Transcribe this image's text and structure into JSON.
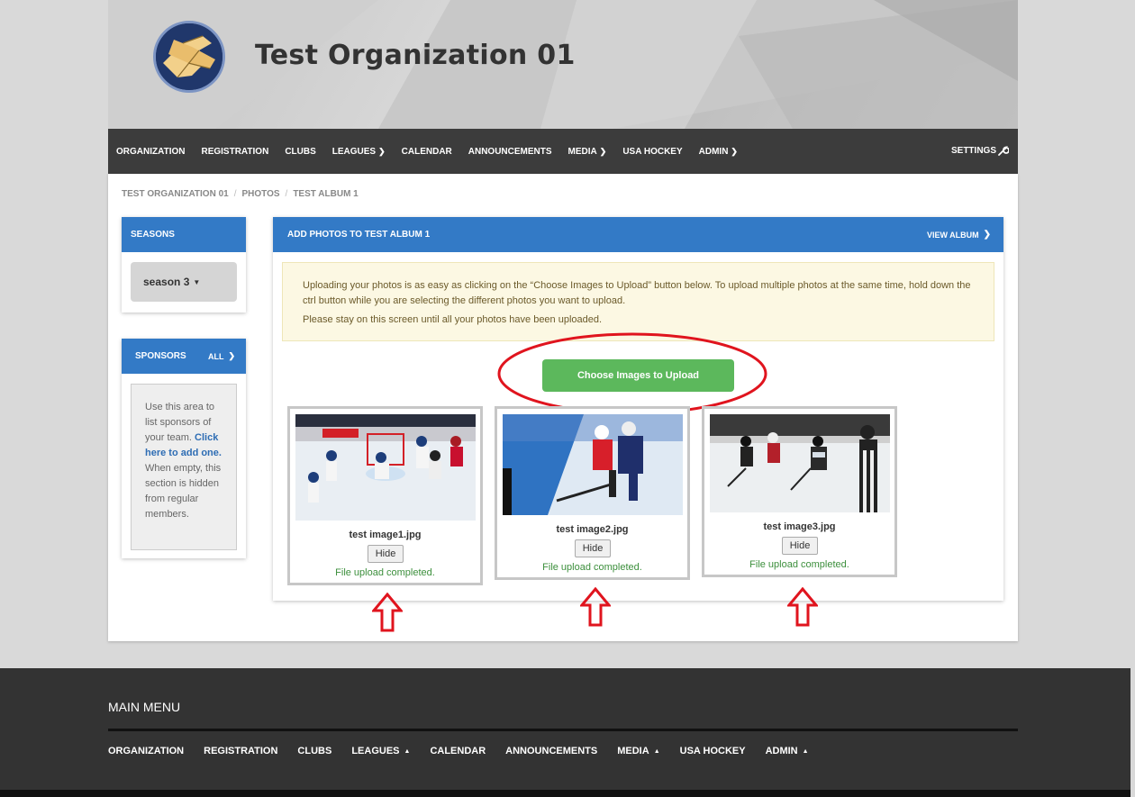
{
  "header": {
    "org_name": "Test Organization 01",
    "logo_icon": "hands-logo-icon"
  },
  "topnav": {
    "items": [
      {
        "label": "ORGANIZATION",
        "dropdown": false
      },
      {
        "label": "REGISTRATION",
        "dropdown": false
      },
      {
        "label": "CLUBS",
        "dropdown": false
      },
      {
        "label": "LEAGUES",
        "dropdown": true
      },
      {
        "label": "CALENDAR",
        "dropdown": false
      },
      {
        "label": "ANNOUNCEMENTS",
        "dropdown": false
      },
      {
        "label": "MEDIA",
        "dropdown": true
      },
      {
        "label": "USA HOCKEY",
        "dropdown": false
      },
      {
        "label": "ADMIN",
        "dropdown": true
      }
    ],
    "settings_label": "SETTINGS"
  },
  "breadcrumb": [
    "TEST ORGANIZATION 01",
    "PHOTOS",
    "TEST ALBUM 1"
  ],
  "sidebar": {
    "seasons_title": "SEASONS",
    "season_selected": "season 3",
    "sponsors_title": "SPONSORS",
    "sponsors_all": "ALL",
    "sponsor_text_1": "Use this area to list sponsors of your team.",
    "sponsor_link": "Click here to add one.",
    "sponsor_text_2": "When empty, this section is hidden from regular members."
  },
  "photo_panel": {
    "title": "ADD PHOTOS TO TEST ALBUM 1",
    "view_album": "VIEW ALBUM",
    "notice_line1": "Uploading your photos is as easy as clicking on the “Choose Images to Upload” button below. To upload multiple photos at the same time, hold down the ctrl button while you are selecting the different photos you want to upload.",
    "notice_line2": "Please stay on this screen until all your photos have been uploaded.",
    "upload_button": "Choose Images to Upload",
    "uploads": [
      {
        "filename": "test image1.jpg",
        "hide_label": "Hide",
        "status": "File upload completed."
      },
      {
        "filename": "test image2.jpg",
        "hide_label": "Hide",
        "status": "File upload completed."
      },
      {
        "filename": "test image3.jpg",
        "hide_label": "Hide",
        "status": "File upload completed."
      }
    ]
  },
  "footer": {
    "title": "MAIN MENU",
    "items": [
      {
        "label": "ORGANIZATION",
        "dropdown": false
      },
      {
        "label": "REGISTRATION",
        "dropdown": false
      },
      {
        "label": "CLUBS",
        "dropdown": false
      },
      {
        "label": "LEAGUES",
        "dropdown": true
      },
      {
        "label": "CALENDAR",
        "dropdown": false
      },
      {
        "label": "ANNOUNCEMENTS",
        "dropdown": false
      },
      {
        "label": "MEDIA",
        "dropdown": true
      },
      {
        "label": "USA HOCKEY",
        "dropdown": false
      },
      {
        "label": "ADMIN",
        "dropdown": true
      }
    ]
  },
  "colors": {
    "nav_bg": "#3c3c3c",
    "panel_blue": "#337ac6",
    "upload_green": "#5cb85c",
    "annotation_red": "#e0141e",
    "footer_bg": "#333333"
  }
}
